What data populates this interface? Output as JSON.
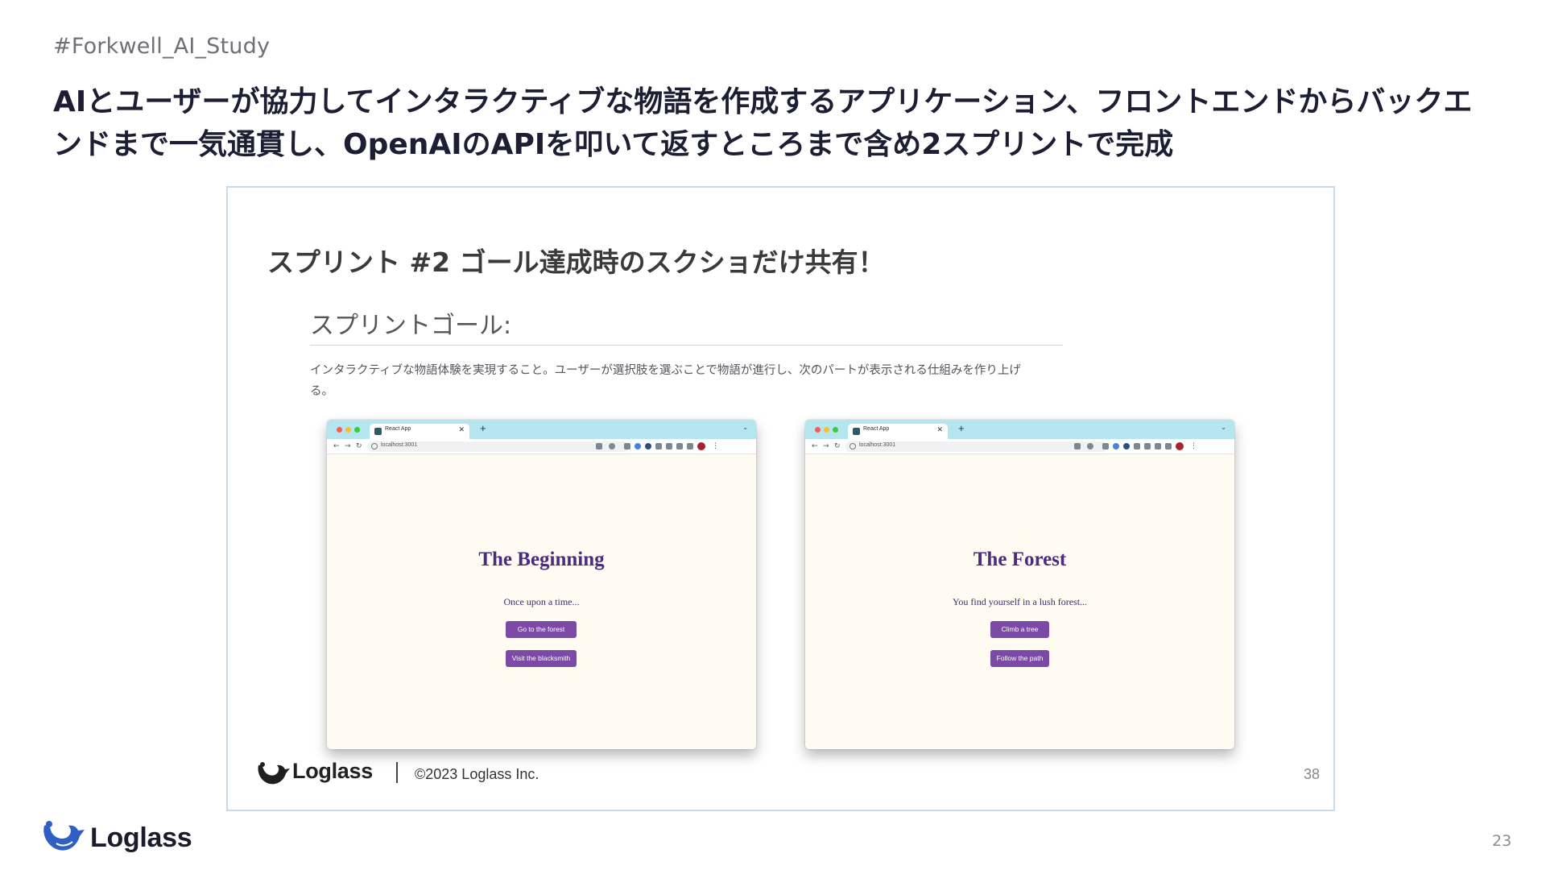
{
  "header": {
    "hashtag": "#Forkwell_AI_Study",
    "headline_line1": "AIとユーザーが協力してインタラクティブな物語を作成するアプリケーション、フロントエンドからバックエ",
    "headline_line2": "ンドまで一気通貫し、OpenAIのAPIを叩いて返すところまで含め2スプリントで完成"
  },
  "embedded_slide": {
    "title": "スプリント #2 ゴール達成時のスクショだけ共有！",
    "goal_heading": "スプリントゴール:",
    "goal_text_line1": "インタラクティブな物語体験を実現すること。ユーザーが選択肢を選ぶことで物語が進行し、次のパートが表示される仕組みを作り上げ",
    "goal_text_line2": "る。",
    "screenshots": [
      {
        "tab_title": "React App",
        "url": "localhost:3001",
        "heading": "The Beginning",
        "text": "Once upon a time...",
        "buttons": [
          "Go to the forest",
          "Visit the blacksmith"
        ]
      },
      {
        "tab_title": "React App",
        "url": "localhost:3001",
        "heading": "The Forest",
        "text": "You find yourself in a lush forest...",
        "buttons": [
          "Climb a tree",
          "Follow the path"
        ]
      }
    ],
    "footer": {
      "logo_text": "Loglass",
      "copyright": "©2023 Loglass Inc.",
      "page_number": "38"
    }
  },
  "footer": {
    "logo_text": "Loglass",
    "page_number": "23"
  },
  "colors": {
    "brand_blue": "#2f5fc4",
    "button_purple": "#7b4aa6",
    "heading_purple": "#4b2b7f",
    "tab_bar": "#b5e6f0",
    "page_bg": "#fffaf2"
  }
}
